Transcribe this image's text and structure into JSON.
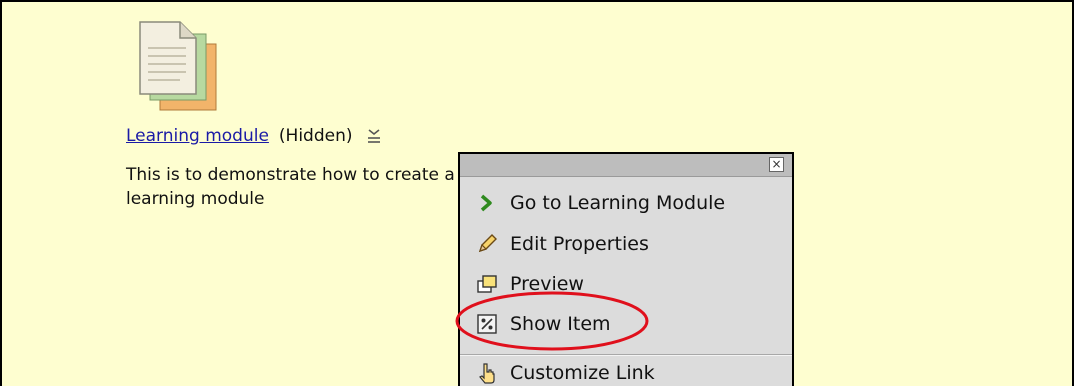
{
  "item": {
    "title": "Learning module ",
    "status": "(Hidden)",
    "description": "This is to demonstrate how to create a learning module"
  },
  "menu": {
    "close_glyph": "×",
    "items": [
      {
        "label": "Go to Learning Module",
        "icon": "green-chevron-right-icon"
      },
      {
        "label": "Edit Properties",
        "icon": "pencil-icon"
      },
      {
        "label": "Preview",
        "icon": "preview-windows-icon"
      },
      {
        "label": "Show Item",
        "icon": "show-item-icon"
      },
      {
        "label": "Customize Link",
        "icon": "hand-pointer-icon"
      }
    ]
  },
  "colors": {
    "background": "#fefed0",
    "link": "#1a1aa6",
    "menu_background": "#dcdcdc",
    "highlight": "#e0101c"
  }
}
